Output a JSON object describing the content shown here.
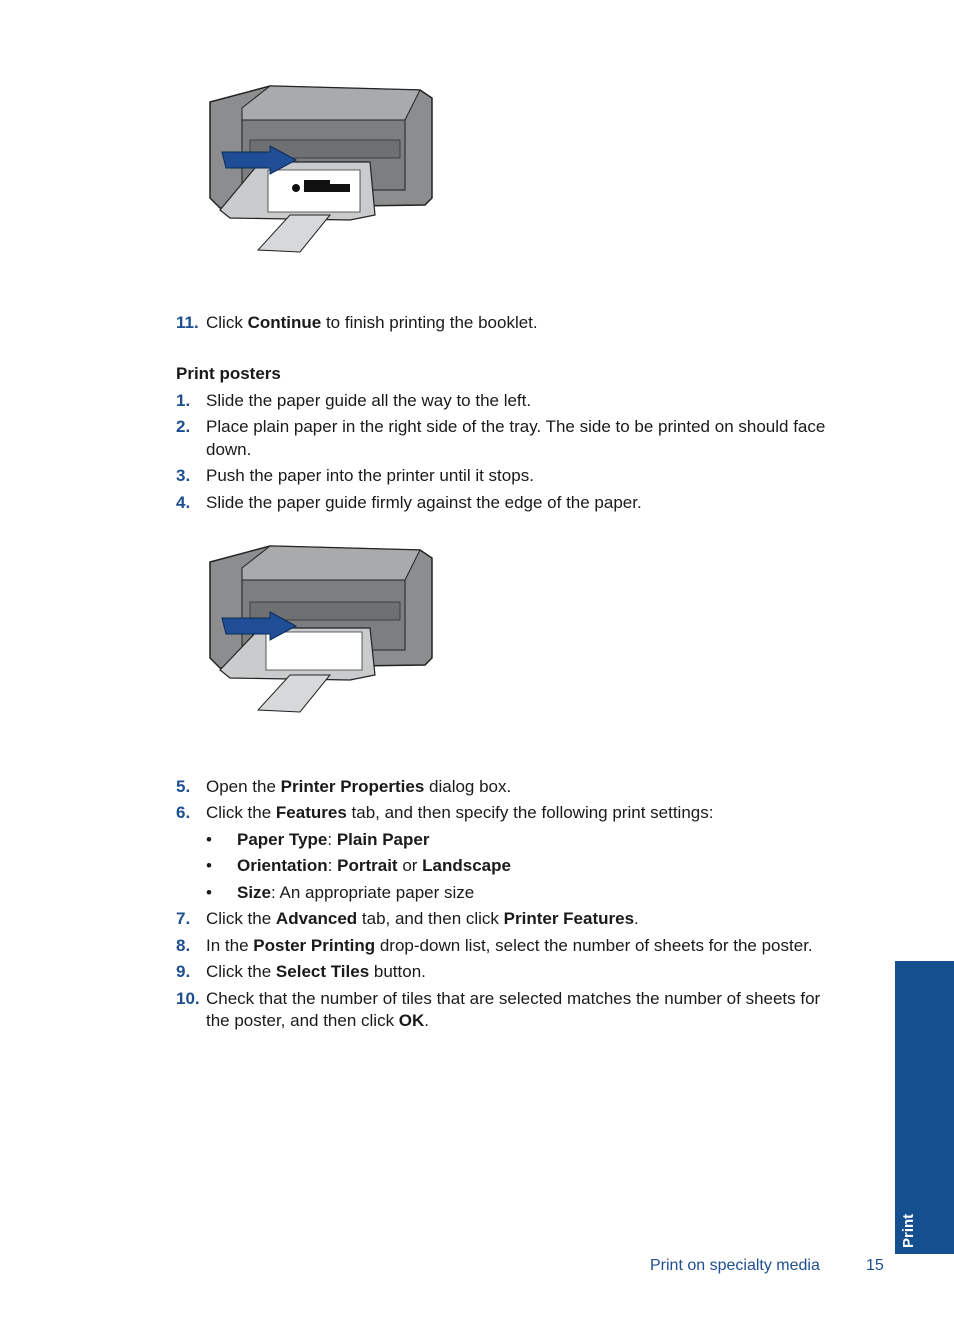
{
  "figures": [
    {
      "name": "printer-loading-booklet-figure",
      "description": "Printer with paper loaded in tray and arrow pointing into printer, paper shows printed image"
    },
    {
      "name": "printer-loading-poster-figure",
      "description": "Printer with blank paper loaded in tray and arrow pointing into printer"
    }
  ],
  "step11": {
    "num": "11.",
    "pre": "Click ",
    "bold": "Continue",
    "post": " to finish printing the booklet."
  },
  "section_heading": "Print posters",
  "steps_a": [
    {
      "num": "1.",
      "text": "Slide the paper guide all the way to the left."
    },
    {
      "num": "2.",
      "text": "Place plain paper in the right side of the tray. The side to be printed on should face",
      "cont": "down."
    },
    {
      "num": "3.",
      "text": "Push the paper into the printer until it stops."
    },
    {
      "num": "4.",
      "text": "Slide the paper guide firmly against the edge of the paper."
    }
  ],
  "step5": {
    "num": "5.",
    "pre": "Open the ",
    "bold": "Printer Properties",
    "post": " dialog box."
  },
  "step6": {
    "num": "6.",
    "pre": "Click the ",
    "bold": "Features",
    "post": " tab, and then specify the following print settings:"
  },
  "bullets": [
    {
      "b1": "Paper Type",
      "sep": ": ",
      "b2": "Plain Paper"
    },
    {
      "b1": "Orientation",
      "sep": ": ",
      "b2": "Portrait",
      "mid": " or ",
      "b3": "Landscape"
    },
    {
      "b1": "Size",
      "rest": ": An appropriate paper size"
    }
  ],
  "bullet_char": "•",
  "step7": {
    "num": "7.",
    "pre": "Click the ",
    "bold": "Advanced",
    "mid": " tab, and then click ",
    "bold2": "Printer Features",
    "post": "."
  },
  "step8": {
    "num": "8.",
    "pre": "In the ",
    "bold": "Poster Printing",
    "post": " drop-down list, select the number of sheets for the poster."
  },
  "step9": {
    "num": "9.",
    "pre": "Click the ",
    "bold": "Select Tiles",
    "post": " button."
  },
  "step10": {
    "num": "10.",
    "pre": "Check that the number of tiles that are selected matches the number of sheets for",
    "cont_pre": "the poster, and then click ",
    "cont_bold": "OK",
    "cont_post": "."
  },
  "side_tab": {
    "label": "Print",
    "color": "#14508f"
  },
  "footer": {
    "section": "Print on specialty media",
    "page": "15"
  },
  "colors": {
    "accent": "#1d4f91",
    "printer_body": "#8c8e90",
    "arrow": "#1f4e96"
  }
}
